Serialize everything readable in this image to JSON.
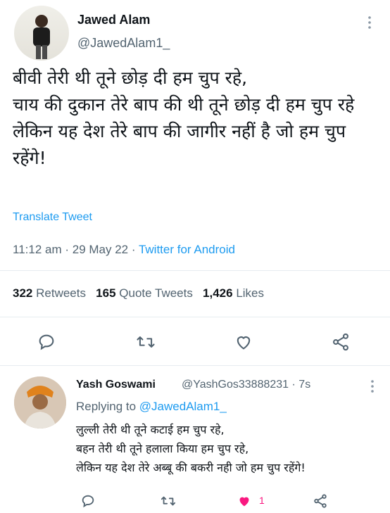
{
  "tweet": {
    "author_name": "Jawed Alam",
    "author_handle": "@JawedAlam1_",
    "text": "बीवी तेरी थी तूने छोड़ दी हम चुप रहे,\nचाय की दुकान तेरे बाप की थी तूने छोड़ दी हम चुप रहे\nलेकिन यह देश तेरे बाप की जागीर नहीं है जो हम चुप रहेंगे!",
    "translate_label": "Translate Tweet",
    "time": "11:12 am",
    "date": "29 May 22",
    "source": "Twitter for Android",
    "stats": {
      "retweets_count": "322",
      "retweets_label": "Retweets",
      "quotes_count": "165",
      "quotes_label": "Quote Tweets",
      "likes_count": "1,426",
      "likes_label": "Likes"
    }
  },
  "reply": {
    "author_name": "Yash Goswami",
    "author_handle": "@YashGos33888231",
    "time_ago": "7s",
    "replying_prefix": "Replying to",
    "replying_to": "@JawedAlam1_",
    "text": "लुल्ली तेरी थी तूने कटाई हम चुप रहे,\nबहन तेरी थी तूने हलाला किया हम चुप रहे,\nलेकिन यह देश तेरे अब्बू की बकरी नही जो हम चुप रहेंगे!",
    "like_count": "1"
  },
  "colors": {
    "accent": "#1d9bf0",
    "like": "#f91880",
    "secondary_text": "#536471"
  },
  "icons": [
    "more-options-icon",
    "reply-icon",
    "retweet-icon",
    "like-icon",
    "share-icon"
  ]
}
